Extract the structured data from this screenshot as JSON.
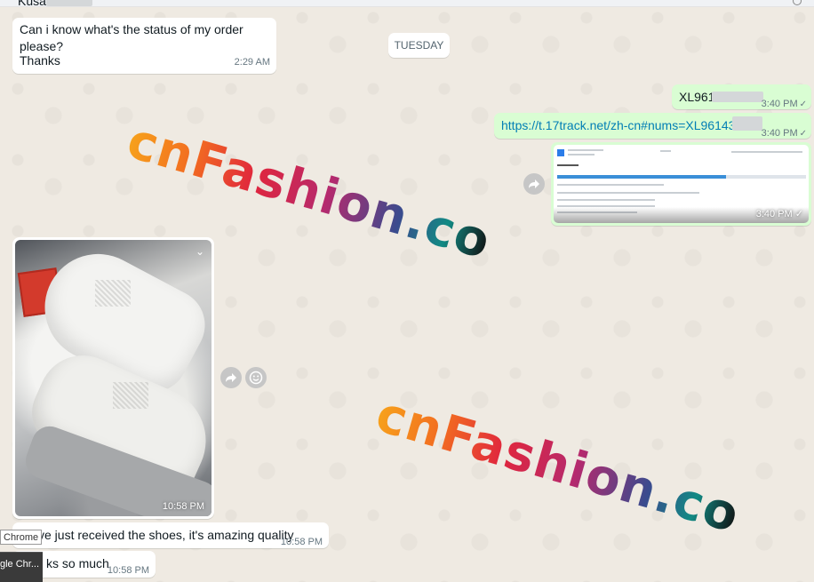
{
  "header": {
    "contact_name": "Kusa"
  },
  "messages": {
    "status_question": "Can i know what's the status of my order please?",
    "thanks": "Thanks",
    "thanks_time": "2:29 AM",
    "day_divider": "TUESDAY",
    "tracking_prefix": "XL961",
    "tracking_time": "3:40 PM",
    "tracking_link": "https://t.17track.net/zh-cn#nums=XL9614332",
    "link_time": "3:40 PM",
    "screenshot_time": "3:40 PM",
    "photo_time": "10:58 PM",
    "received": "ve just received the shoes, it's amazing quality",
    "received_time": "10:58 PM",
    "thanks_much": "ks so much",
    "thanks_much_time": "10:58 PM"
  },
  "watermark": {
    "text_main": "cnFashion",
    "text_tld": ".co"
  },
  "overlay": {
    "tooltip": "Chrome",
    "taskbar_label": "gle Chr..."
  },
  "icons": {
    "forward": "forward-icon",
    "emoji": "emoji-icon",
    "chevron": "chevron-down-icon",
    "read_check": "double-check-icon"
  },
  "colors": {
    "chat_bg": "#efeae2",
    "incoming": "#ffffff",
    "outgoing": "#d9fdd3",
    "link": "#027eb5"
  }
}
